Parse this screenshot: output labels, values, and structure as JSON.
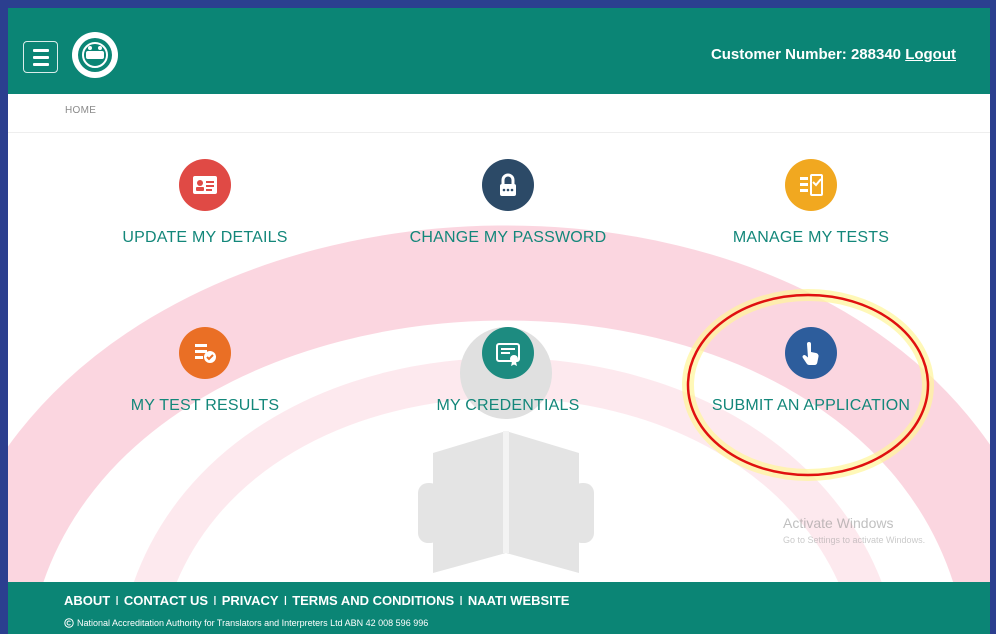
{
  "header": {
    "customer_label": "Customer Number: 288340",
    "logout_label": "Logout"
  },
  "breadcrumb": "HOME",
  "tiles": [
    {
      "label": "UPDATE MY DETAILS",
      "icon": "id-card-icon"
    },
    {
      "label": "CHANGE MY PASSWORD",
      "icon": "lock-icon"
    },
    {
      "label": "MANAGE MY TESTS",
      "icon": "checklist-icon"
    },
    {
      "label": "MY TEST RESULTS",
      "icon": "results-check-icon"
    },
    {
      "label": "MY CREDENTIALS",
      "icon": "certificate-icon"
    },
    {
      "label": "SUBMIT AN APPLICATION",
      "icon": "pointing-hand-icon"
    }
  ],
  "watermark": {
    "title": "Activate Windows",
    "subtitle": "Go to Settings to activate Windows."
  },
  "footer": {
    "links": [
      "ABOUT",
      "CONTACT US",
      "PRIVACY",
      "TERMS AND CONDITIONS",
      "NAATI WEBSITE"
    ],
    "separator": "I",
    "copyright": "National Accreditation Authority for Translators and Interpreters Ltd ABN 42 008 596 996"
  },
  "colors": {
    "header_bg": "#0b8575",
    "label_text": "#13877a",
    "highlight_ring": "#e01010",
    "highlight_glow": "#fff59a"
  }
}
